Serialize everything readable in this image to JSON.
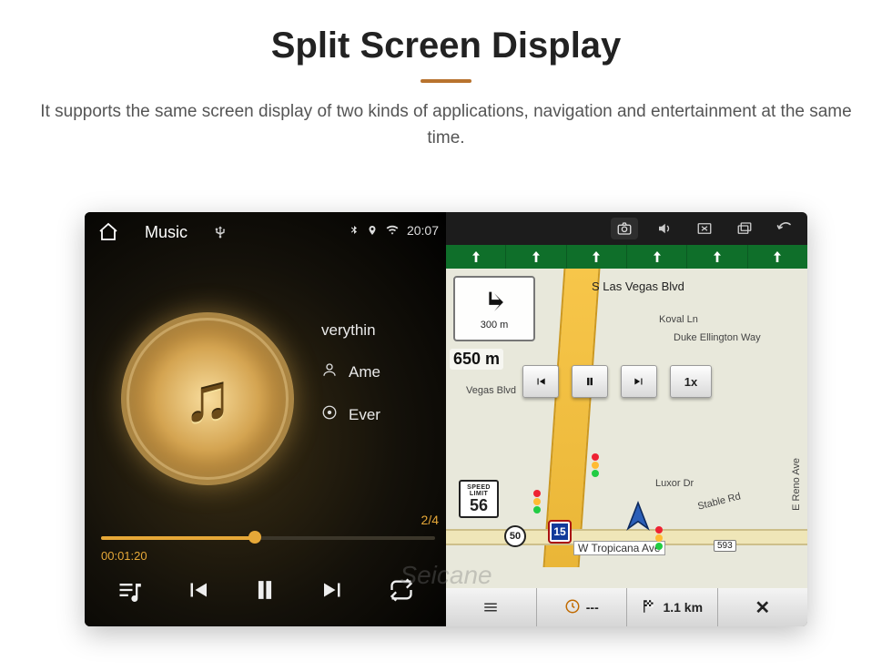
{
  "hero": {
    "title": "Split Screen Display",
    "description": "It supports the same screen display of two kinds of applications, navigation and entertainment at the same time."
  },
  "statusbar": {
    "time": "20:07",
    "icons": [
      "bluetooth-icon",
      "location-icon",
      "wifi-icon"
    ]
  },
  "nav_top_icons": [
    "camera-icon",
    "volume-icon",
    "close-window-icon",
    "multitask-icon",
    "back-icon"
  ],
  "music": {
    "header_label": "Music",
    "source_icon": "usb-icon",
    "track_title": "verythin",
    "artist": "Ame",
    "album": "Ever",
    "track_index": "2/4",
    "elapsed": "00:01:20",
    "progress_pct": 46,
    "controls": [
      "playlist-icon",
      "prev-icon",
      "pause-icon",
      "next-icon",
      "repeat-icon"
    ]
  },
  "nav": {
    "lane_arrows": 6,
    "turn": {
      "distance_small": "300 m",
      "distance_big": "650 m"
    },
    "streets": {
      "s_las_vegas": "S Las Vegas Blvd",
      "koval": "Koval Ln",
      "duke": "Duke Ellington Way",
      "vegas_blvd": "Vegas Blvd",
      "luxor": "Luxor Dr",
      "stable": "Stable Rd",
      "reno": "E Reno Ave",
      "tropicana": "W Tropicana Ave",
      "trop_route": "593"
    },
    "speed_limit": {
      "label_top": "SPEED",
      "label_mid": "LIMIT",
      "value": "56"
    },
    "interstate": "15",
    "route_shield": "50",
    "sim_controls": {
      "prev": "prev",
      "pause": "pause",
      "next": "next",
      "speed": "1x"
    },
    "bottom": {
      "eta_icon": "clock-icon",
      "eta": "---",
      "flag_icon": "checkered-flag-icon",
      "remaining": "1.1 km",
      "close": "✕"
    }
  },
  "watermark": "Seicane"
}
